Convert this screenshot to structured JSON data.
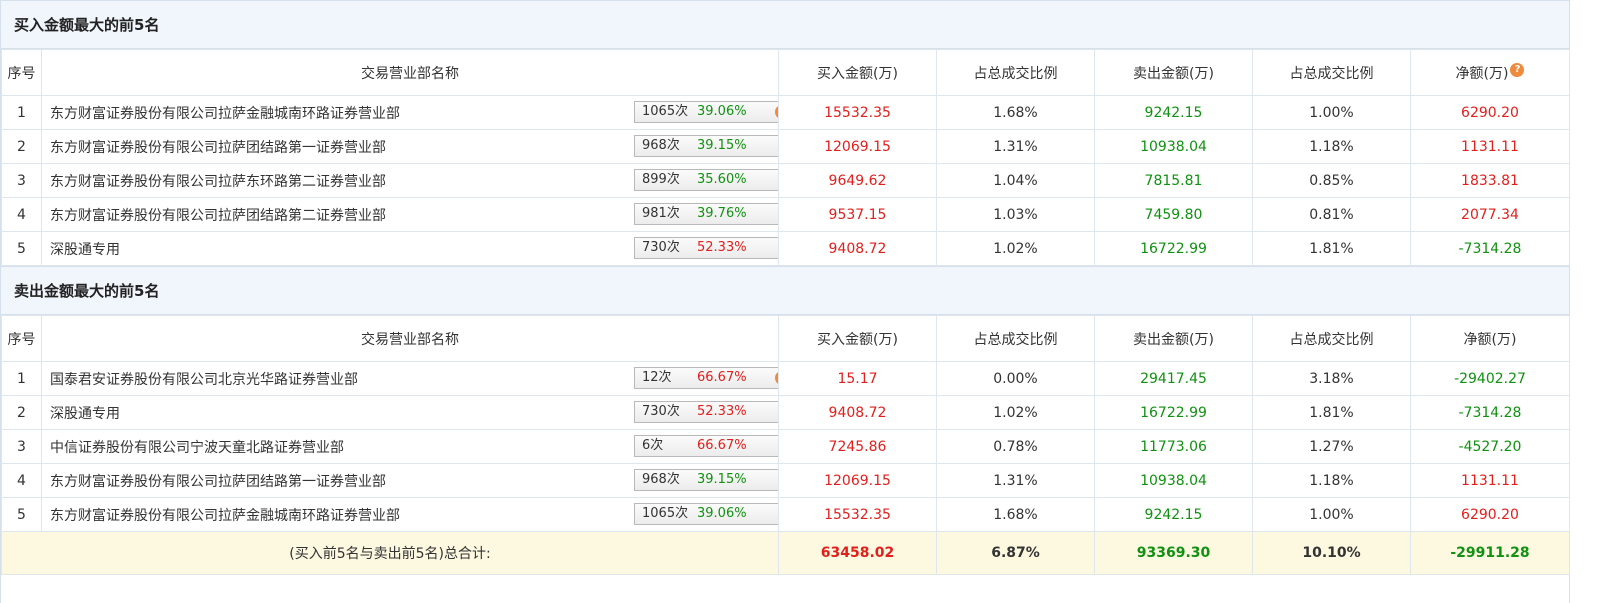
{
  "buy_section": {
    "title": "买入金额最大的前5名",
    "headers": [
      "序号",
      "交易营业部名称",
      "买入金额(万)",
      "占总成交比例",
      "卖出金额(万)",
      "占总成交比例",
      "净额(万)"
    ],
    "rows": [
      {
        "no": "1",
        "name": "东方财富证券股份有限公司拉萨金融城南环路证券营业部",
        "count": "1065次",
        "pct": "39.06%",
        "icon": "help-icon",
        "buy": "15532.35",
        "buy_ratio": "1.68%",
        "sell": "9242.15",
        "sell_ratio": "1.00%",
        "net": "6290.20"
      },
      {
        "no": "2",
        "name": "东方财富证券股份有限公司拉萨团结路第一证券营业部",
        "count": "968次",
        "pct": "39.15%",
        "icon": "arrow-right-icon",
        "buy": "12069.15",
        "buy_ratio": "1.31%",
        "sell": "10938.04",
        "sell_ratio": "1.18%",
        "net": "1131.11"
      },
      {
        "no": "3",
        "name": "东方财富证券股份有限公司拉萨东环路第二证券营业部",
        "count": "899次",
        "pct": "35.60%",
        "icon": "arrow-right-icon",
        "buy": "9649.62",
        "buy_ratio": "1.04%",
        "sell": "7815.81",
        "sell_ratio": "0.85%",
        "net": "1833.81"
      },
      {
        "no": "4",
        "name": "东方财富证券股份有限公司拉萨团结路第二证券营业部",
        "count": "981次",
        "pct": "39.76%",
        "icon": "arrow-right-icon",
        "buy": "9537.15",
        "buy_ratio": "1.03%",
        "sell": "7459.80",
        "sell_ratio": "0.81%",
        "net": "2077.34"
      },
      {
        "no": "5",
        "name": "深股通专用",
        "count": "730次",
        "pct": "52.33%",
        "pct_red": true,
        "icon": "arrow-right-icon",
        "buy": "9408.72",
        "buy_ratio": "1.02%",
        "sell": "16722.99",
        "sell_ratio": "1.81%",
        "net": "-7314.28"
      }
    ]
  },
  "sell_section": {
    "title": "卖出金额最大的前5名",
    "headers": [
      "序号",
      "交易营业部名称",
      "买入金额(万)",
      "占总成交比例",
      "卖出金额(万)",
      "占总成交比例",
      "净额(万)"
    ],
    "rows": [
      {
        "no": "1",
        "name": "国泰君安证券股份有限公司北京光华路证券营业部",
        "count": "12次",
        "pct": "66.67%",
        "pct_red": true,
        "icon": "help-icon",
        "buy": "15.17",
        "buy_ratio": "0.00%",
        "sell": "29417.45",
        "sell_ratio": "3.18%",
        "net": "-29402.27"
      },
      {
        "no": "2",
        "name": "深股通专用",
        "count": "730次",
        "pct": "52.33%",
        "pct_red": true,
        "icon": "arrow-right-icon",
        "buy": "9408.72",
        "buy_ratio": "1.02%",
        "sell": "16722.99",
        "sell_ratio": "1.81%",
        "net": "-7314.28"
      },
      {
        "no": "3",
        "name": "中信证券股份有限公司宁波天童北路证券营业部",
        "count": "6次",
        "pct": "66.67%",
        "pct_red": true,
        "icon": "arrow-right-icon",
        "buy": "7245.86",
        "buy_ratio": "0.78%",
        "sell": "11773.06",
        "sell_ratio": "1.27%",
        "net": "-4527.20"
      },
      {
        "no": "4",
        "name": "东方财富证券股份有限公司拉萨团结路第一证券营业部",
        "count": "968次",
        "pct": "39.15%",
        "icon": "arrow-right-icon",
        "buy": "12069.15",
        "buy_ratio": "1.31%",
        "sell": "10938.04",
        "sell_ratio": "1.18%",
        "net": "1131.11"
      },
      {
        "no": "5",
        "name": "东方财富证券股份有限公司拉萨金融城南环路证券营业部",
        "count": "1065次",
        "pct": "39.06%",
        "icon": "arrow-right-icon",
        "buy": "15532.35",
        "buy_ratio": "1.68%",
        "sell": "9242.15",
        "sell_ratio": "1.00%",
        "net": "6290.20"
      }
    ]
  },
  "total": {
    "label": "(买入前5名与卖出前5名)总合计:",
    "buy": "63458.02",
    "buy_ratio": "6.87%",
    "sell": "93369.30",
    "sell_ratio": "10.10%",
    "net": "-29911.28"
  },
  "icons": {
    "help": "?",
    "help_color": "#f08a3c",
    "arrow_color": "#1f4e8c"
  },
  "colors": {
    "positive": "#e0201d",
    "negative": "#119111",
    "header_bg": "#f0f6fc",
    "total_bg": "#fdf8e0"
  }
}
